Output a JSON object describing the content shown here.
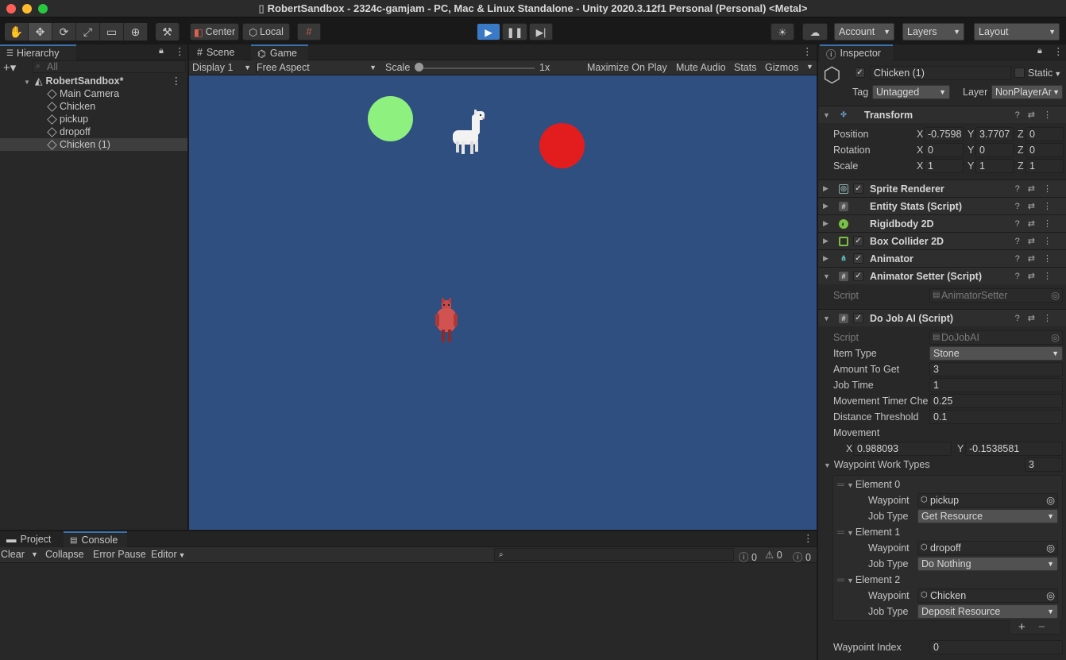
{
  "window": {
    "title": "RobertSandbox - 2324c-gamjam - PC, Mac & Linux Standalone - Unity 2020.3.12f1 Personal (Personal) <Metal>"
  },
  "toolbar": {
    "pivot_label": "Center",
    "space_label": "Local",
    "account_label": "Account",
    "layers_label": "Layers",
    "layout_label": "Layout"
  },
  "hierarchy": {
    "tab_label": "Hierarchy",
    "search_placeholder": "All",
    "scene_name": "RobertSandbox*",
    "objects": [
      "Main Camera",
      "Chicken",
      "pickup",
      "dropoff",
      "Chicken (1)"
    ]
  },
  "game_view": {
    "tabs": [
      "Scene",
      "Game"
    ],
    "display_label": "Display 1",
    "aspect_label": "Free Aspect",
    "scale_label": "Scale",
    "scale_value": "1x",
    "maximize_label": "Maximize On Play",
    "mute_label": "Mute Audio",
    "stats_label": "Stats",
    "gizmos_label": "Gizmos",
    "background_color": "#2f4f80",
    "pickup_color": "#8ef07e",
    "dropoff_color": "#e31d1d"
  },
  "console": {
    "tabs": [
      "Project",
      "Console"
    ],
    "clear_label": "Clear",
    "collapse_label": "Collapse",
    "error_pause_label": "Error Pause",
    "editor_label": "Editor",
    "counts": [
      "0",
      "0",
      "0"
    ]
  },
  "inspector": {
    "tab_label": "Inspector",
    "object_name": "Chicken (1)",
    "static_label": "Static",
    "tag_label": "Tag",
    "tag_value": "Untagged",
    "layer_label": "Layer",
    "layer_value": "NonPlayerAr",
    "transform": {
      "title": "Transform",
      "position_label": "Position",
      "rotation_label": "Rotation",
      "scale_label": "Scale",
      "position": [
        "-0.7598",
        "3.7707",
        "0"
      ],
      "rotation": [
        "0",
        "0",
        "0"
      ],
      "scale": [
        "1",
        "1",
        "1"
      ]
    },
    "components": [
      "Sprite Renderer",
      "Entity Stats (Script)",
      "Rigidbody 2D",
      "Box Collider 2D",
      "Animator",
      "Animator Setter (Script)"
    ],
    "animator_setter": {
      "script_label": "Script",
      "script_value": "AnimatorSetter"
    },
    "do_job": {
      "title": "Do Job AI (Script)",
      "script_label": "Script",
      "script_value": "DoJobAI",
      "item_type_label": "Item Type",
      "item_type_value": "Stone",
      "amount_label": "Amount To Get",
      "amount_value": "3",
      "job_time_label": "Job Time",
      "job_time_value": "1",
      "movement_timer_label": "Movement Timer Che",
      "movement_timer_value": "0.25",
      "distance_label": "Distance Threshold",
      "distance_value": "0.1",
      "movement_label": "Movement",
      "movement_x": "0.988093",
      "movement_y": "-0.1538581",
      "waypoint_types_label": "Waypoint Work Types",
      "waypoint_types_count": "3",
      "elements": [
        {
          "label": "Element 0",
          "waypoint": "pickup",
          "job_type": "Get Resource"
        },
        {
          "label": "Element 1",
          "waypoint": "dropoff",
          "job_type": "Do Nothing"
        },
        {
          "label": "Element 2",
          "waypoint": "Chicken",
          "job_type": "Deposit Resource"
        }
      ],
      "waypoint_field_label": "Waypoint",
      "job_type_field_label": "Job Type",
      "waypoint_index_label": "Waypoint Index",
      "waypoint_index_value": "0"
    }
  }
}
